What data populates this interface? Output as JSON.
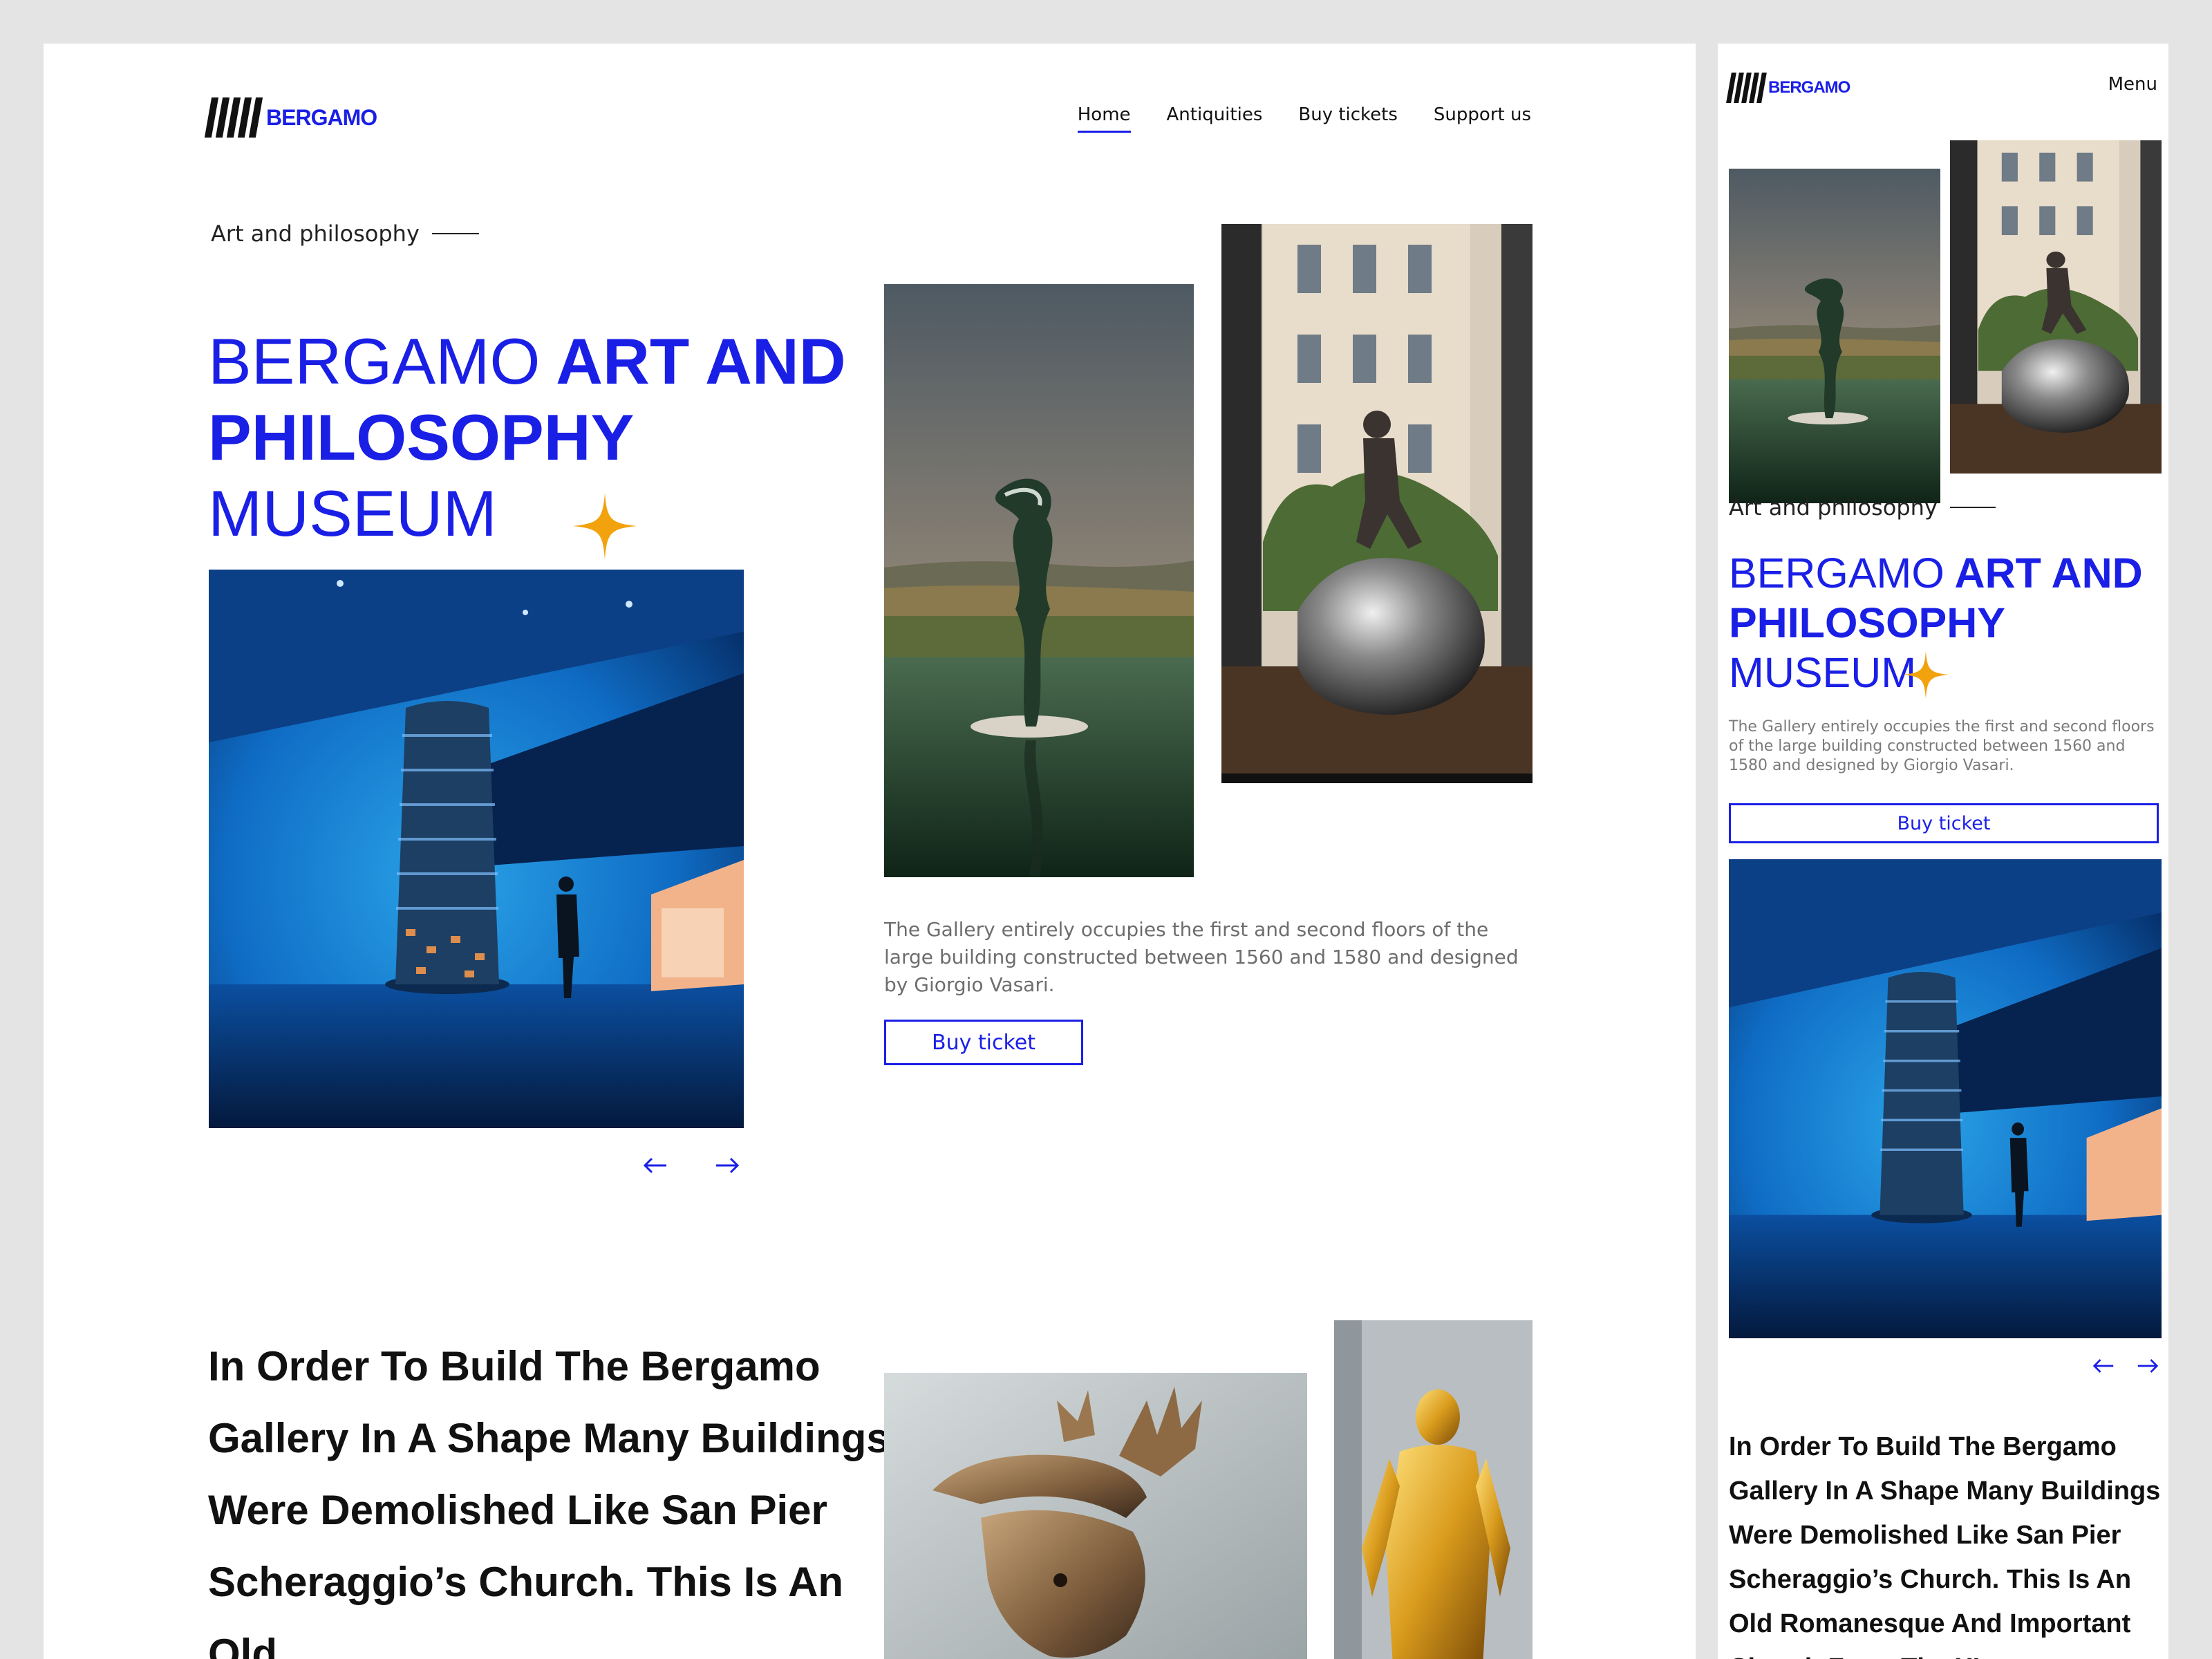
{
  "brand": {
    "name": "BERGAMO",
    "accent_color": "#1a1fe6",
    "star_color": "#f2a20c"
  },
  "nav": {
    "items": [
      {
        "label": "Home",
        "active": true
      },
      {
        "label": "Antiquities",
        "active": false
      },
      {
        "label": "Buy tickets",
        "active": false
      },
      {
        "label": "Support us",
        "active": false
      }
    ],
    "mobile_menu_label": "Menu"
  },
  "hero": {
    "eyebrow": "Art and philosophy",
    "title_line1_thin": "BERGAMO",
    "title_line1_bold": "ART AND",
    "title_line2_bold": "PHILOSOPHY",
    "title_line3_thin": "MUSEUM",
    "description": "The Gallery entirely occupies the first and second floors of the large building constructed between 1560 and 1580 and designed by Giorgio Vasari.",
    "cta_label": "Buy ticket"
  },
  "carousel": {
    "prev_icon": "arrow-left-icon",
    "next_icon": "arrow-right-icon"
  },
  "history": {
    "desktop_text": "In Order To Build The Bergamo Gallery In A Shape Many Buildings Were Demolished Like San Pier Scheraggio’s Church. This Is An Old",
    "mobile_text": "In Order To Build The Bergamo Gallery In A Shape Many Buildings Were Demolished Like San Pier Scheraggio’s Church. This Is An Old Romanesque And Important Church From The XI"
  }
}
